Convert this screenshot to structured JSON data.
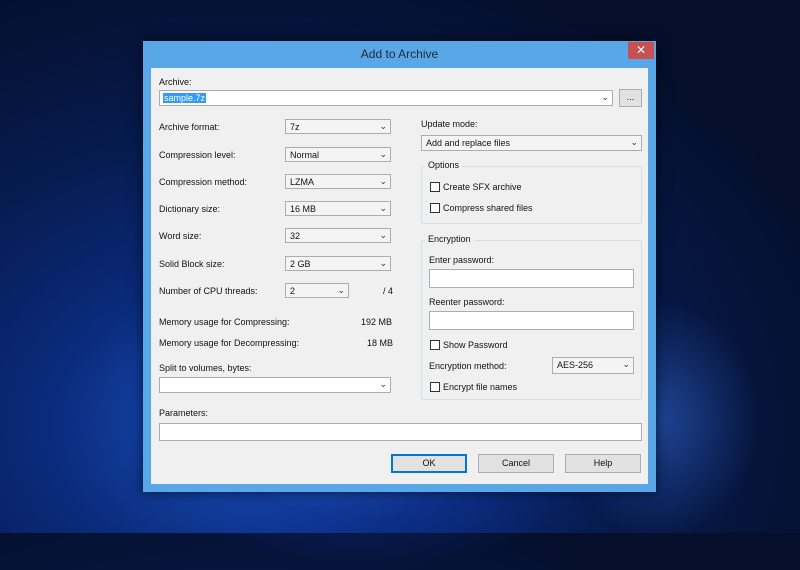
{
  "window": {
    "title": "Add to Archive",
    "close_label": "✕"
  },
  "archive": {
    "label": "Archive:",
    "value": "sample.7z",
    "browse_label": "..."
  },
  "left": {
    "archive_format": {
      "label": "Archive format:",
      "value": "7z"
    },
    "compression_level": {
      "label": "Compression level:",
      "value": "Normal"
    },
    "compression_method": {
      "label": "Compression method:",
      "value": "LZMA"
    },
    "dictionary_size": {
      "label": "Dictionary size:",
      "value": "16 MB"
    },
    "word_size": {
      "label": "Word size:",
      "value": "32"
    },
    "solid_block_size": {
      "label": "Solid Block size:",
      "value": "2 GB"
    },
    "cpu_threads": {
      "label": "Number of CPU threads:",
      "value": "2",
      "max": "/ 4"
    },
    "mem_compress": {
      "label": "Memory usage for Compressing:",
      "value": "192 MB"
    },
    "mem_decompress": {
      "label": "Memory usage for Decompressing:",
      "value": "18 MB"
    },
    "split": {
      "label": "Split to volumes, bytes:",
      "value": ""
    }
  },
  "right": {
    "update_mode": {
      "label": "Update mode:",
      "value": "Add and replace files"
    },
    "options": {
      "title": "Options",
      "sfx_label": "Create SFX archive",
      "compress_shared_label": "Compress shared files"
    },
    "encryption": {
      "title": "Encryption",
      "enter_password_label": "Enter password:",
      "reenter_password_label": "Reenter password:",
      "show_password_label": "Show Password",
      "method_label": "Encryption method:",
      "method_value": "AES-256",
      "encrypt_names_label": "Encrypt file names"
    }
  },
  "parameters": {
    "label": "Parameters:",
    "value": ""
  },
  "buttons": {
    "ok": "OK",
    "cancel": "Cancel",
    "help": "Help"
  },
  "icons": {
    "dropdown": "chevron-down-icon",
    "close": "close-icon"
  },
  "colors": {
    "title_bar": "#5aa7e8",
    "close_button": "#c75050",
    "selection": "#3399ff"
  }
}
